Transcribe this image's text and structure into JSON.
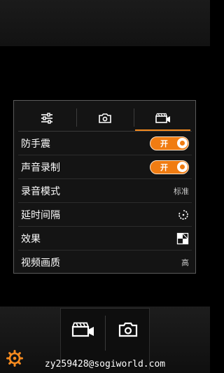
{
  "settings_panel": {
    "tabs": [
      {
        "icon": "sliders-icon",
        "active": false
      },
      {
        "icon": "camera-icon",
        "active": false
      },
      {
        "icon": "video-camera-icon",
        "active": true
      }
    ],
    "rows": [
      {
        "label": "防手震",
        "toggle": "开"
      },
      {
        "label": "声音录制",
        "toggle": "开"
      },
      {
        "label": "录音模式",
        "value": "标准"
      },
      {
        "label": "延时间隔",
        "icon": "timer-icon"
      },
      {
        "label": "效果",
        "icon": "effect-icon"
      },
      {
        "label": "视频画质",
        "value": "高"
      }
    ]
  },
  "bottom_bar": {
    "modes": [
      {
        "icon": "video-camera-icon"
      },
      {
        "icon": "camera-icon"
      }
    ],
    "settings_icon": "gear-icon",
    "watermark": "zy259428@sogiworld.com"
  },
  "colors": {
    "accent": "#f58a1f",
    "toggle_on": "#f07c12",
    "panel_bg": "#141414",
    "panel_border": "#5b5b5b"
  }
}
